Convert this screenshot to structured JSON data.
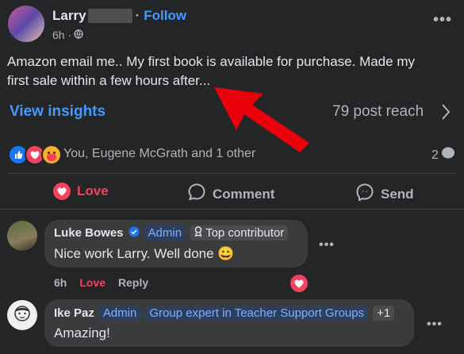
{
  "post": {
    "author": "Larry",
    "follow": "Follow",
    "separator": "·",
    "time": "6h ·",
    "text": "Amazon email me.. My first book is available for purchase. Made my first sale within a few hours after...",
    "insights": "View insights",
    "reach": "79 post reach",
    "reactions_text": "You, Eugene McGrath and 1 other",
    "comment_count": "2"
  },
  "actions": {
    "love": "Love",
    "comment": "Comment",
    "send": "Send"
  },
  "comments": [
    {
      "name": "Luke Bowes",
      "badge_admin": "Admin",
      "badge_top": "Top contributor",
      "text": "Nice work Larry. Well done 😀",
      "time": "6h",
      "love": "Love",
      "reply": "Reply"
    },
    {
      "name": "Ike Paz",
      "badge_admin": "Admin",
      "badge_expert": "Group expert in Teacher Support Groups",
      "badge_more": "+1",
      "text": "Amazing!"
    }
  ],
  "colors": {
    "accent": "#4599ff",
    "love": "#f3425f",
    "arrow": "#e8000b",
    "bg": "#242526"
  }
}
